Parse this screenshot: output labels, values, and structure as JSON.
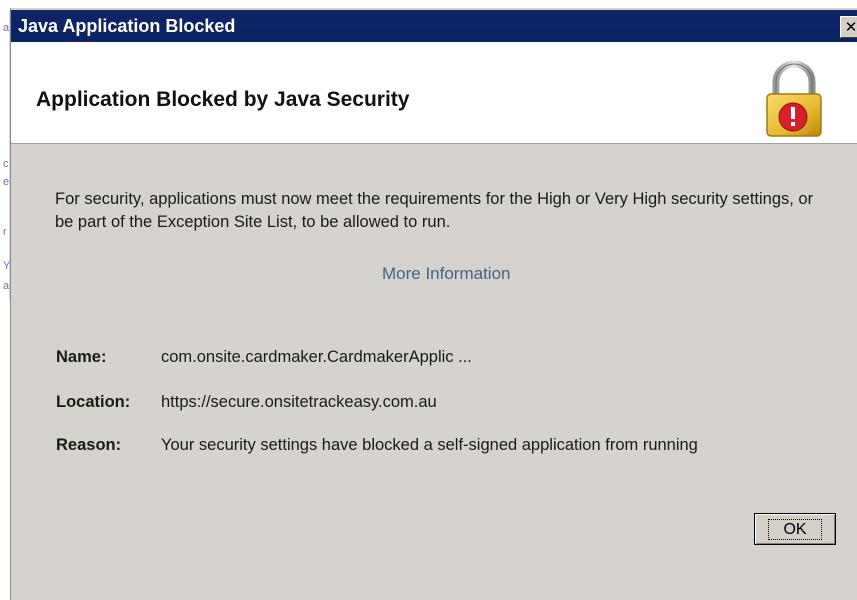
{
  "background": {
    "fragments": [
      "a",
      "c",
      "e",
      "r",
      "Y",
      "a"
    ]
  },
  "window": {
    "title": "Java Application Blocked",
    "close_glyph": "✕"
  },
  "header": {
    "title": "Application Blocked by Java Security",
    "icon": "padlock-warning-icon"
  },
  "message": "For security, applications must now meet the requirements for the High or Very High security settings, or be part of the Exception Site List, to be allowed to run.",
  "more_info_link": "More Information",
  "details": [
    {
      "label": "Name:",
      "value": "com.onsite.cardmaker.CardmakerApplic ..."
    },
    {
      "label": "Location:",
      "value": "https://secure.onsitetrackeasy.com.au"
    },
    {
      "label": "Reason:",
      "value": "Your security settings have blocked a self-signed application from running"
    }
  ],
  "buttons": {
    "ok": "OK"
  },
  "colors": {
    "titlebar": "#0a2461",
    "dialog_bg": "#d6d3ce",
    "link": "#45657e",
    "warning_red": "#d8202a",
    "lock_gold": "#e8b830"
  }
}
